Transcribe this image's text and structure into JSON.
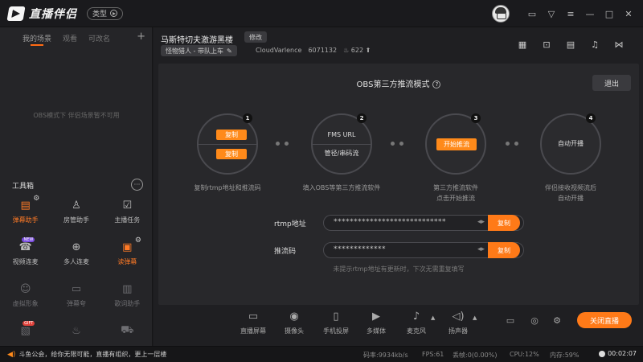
{
  "app": {
    "title": "直播伴侣",
    "type_label": "类型"
  },
  "sidebar": {
    "tabs": [
      "我的场景",
      "观看",
      "可改名"
    ],
    "empty_scene_text": "OBS模式下 伴侣场景暂不可用",
    "tools_title": "工具箱",
    "tools": [
      {
        "label": "弹幕助手",
        "icon": "danmaku-icon",
        "state": "orange",
        "gear": true
      },
      {
        "label": "房管助手",
        "icon": "room-manager-icon",
        "state": "normal"
      },
      {
        "label": "主播任务",
        "icon": "task-icon",
        "state": "normal"
      },
      {
        "label": "视频连麦",
        "icon": "video-connect-icon",
        "state": "normal",
        "tag": "NEW"
      },
      {
        "label": "多人连麦",
        "icon": "multi-connect-icon",
        "state": "normal"
      },
      {
        "label": "读弹幕",
        "icon": "read-danmaku-icon",
        "state": "orange",
        "gear": true
      },
      {
        "label": "虚拟形象",
        "icon": "avatar-icon",
        "state": "dim"
      },
      {
        "label": "弹幕夸",
        "icon": "danmaku-praise-icon",
        "state": "dim"
      },
      {
        "label": "歌词助手",
        "icon": "lyrics-icon",
        "state": "dim"
      },
      {
        "label": "",
        "icon": "gift-icon",
        "state": "dim",
        "tag": "GIFT"
      },
      {
        "label": "",
        "icon": "fire-icon",
        "state": "dim"
      },
      {
        "label": "",
        "icon": "car-icon",
        "state": "dim"
      }
    ]
  },
  "room": {
    "title": "马斯特切夫激游黑楼",
    "edit_label": "修改",
    "category": "怪物猎人 - 带队上车",
    "streamer": "CloudVarlence",
    "room_id": "6071132",
    "heat": "622"
  },
  "obs": {
    "title": "OBS第三方推流模式",
    "exit_label": "退出",
    "steps": [
      {
        "num": "1",
        "btn1": "复制",
        "btn2": "复制",
        "caption": "复制rtmp地址和推流码"
      },
      {
        "num": "2",
        "line1": "FMS URL",
        "line2": "管径/串码流",
        "caption": "填入OBS等第三方推流软件"
      },
      {
        "num": "3",
        "btn": "开始推流",
        "caption": "第三方推流软件\n点击开始推流"
      },
      {
        "num": "4",
        "text": "自动开播",
        "caption": "伴侣接收视频流后\n自动开播"
      }
    ],
    "rtmp_label": "rtmp地址",
    "rtmp_value": "****************************",
    "key_label": "推流码",
    "key_value": "*************",
    "copy_label": "复制",
    "hint": "未提示rtmp地址有更新时，下次无需重复填写"
  },
  "bottom": {
    "tools": [
      "直播屏幕",
      "摄像头",
      "手机投屏",
      "多媒体",
      "麦克风",
      "扬声器"
    ],
    "close_live": "关闭直播"
  },
  "status": {
    "message": "斗鱼公会，给你无限可能，直播有组织，更上一层楼",
    "bitrate": "码率:9934kb/s",
    "fps": "FPS:61",
    "dropped": "丢帧:0(0.00%)",
    "cpu": "CPU:12%",
    "memory": "内存:59%",
    "timer": "00:02:07"
  },
  "colors": {
    "accent": "#ff7a18",
    "background": "#1f1f22",
    "sidebar": "#252528"
  }
}
